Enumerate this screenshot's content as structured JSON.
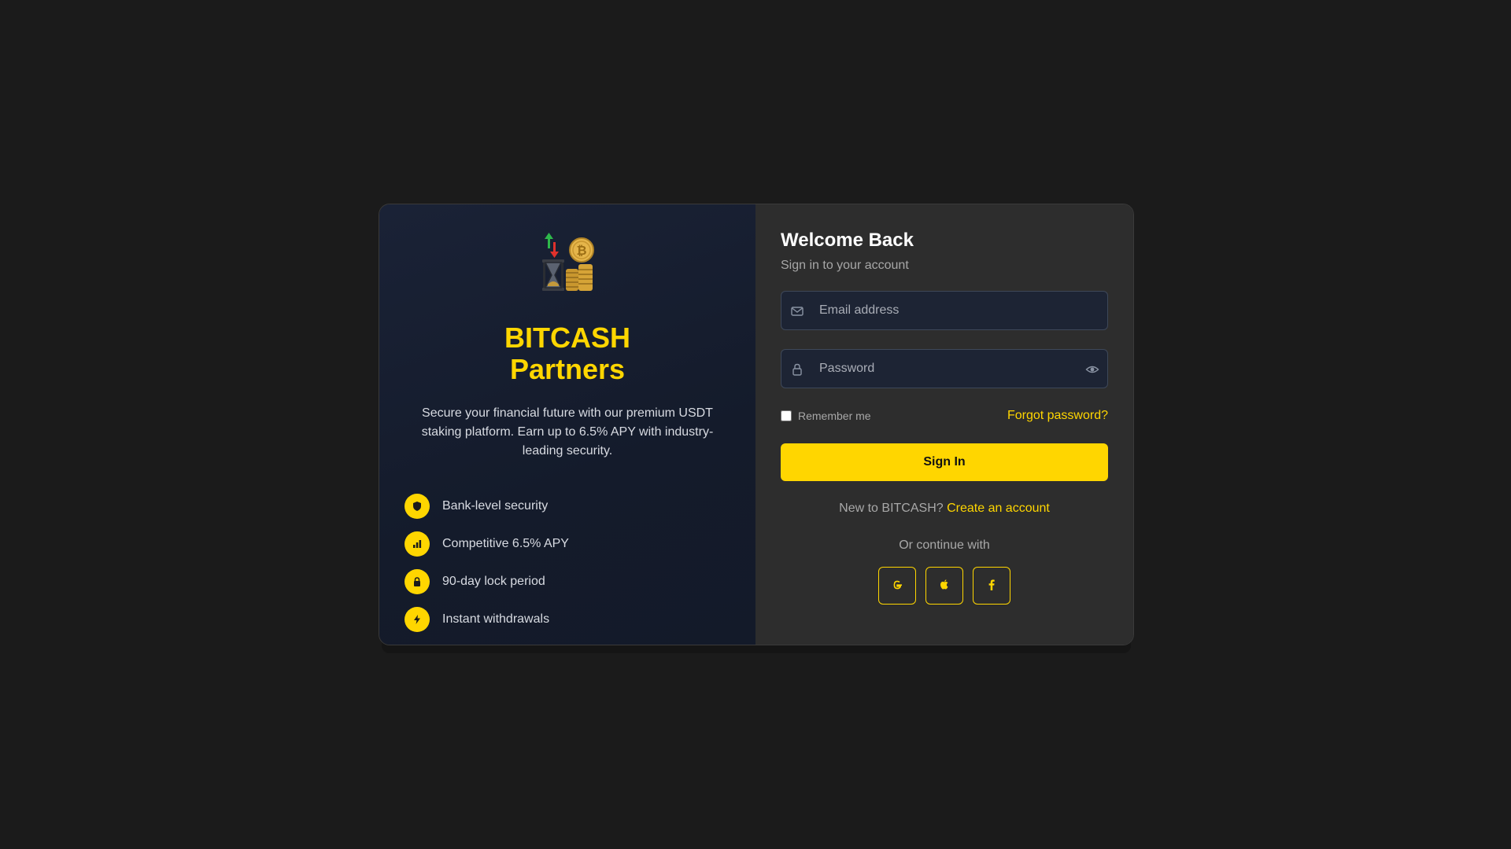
{
  "brand": {
    "name_line1": "BITCASH",
    "name_line2": "Partners",
    "tagline": "Secure your financial future with our premium USDT staking platform. Earn up to 6.5% APY with industry-leading security.",
    "logo_icon": "hourglass-bitcoin-coins-logo"
  },
  "features": [
    {
      "label": "Bank-level security",
      "icon": "shield-icon"
    },
    {
      "label": "Competitive 6.5% APY",
      "icon": "chart-icon"
    },
    {
      "label": "90-day lock period",
      "icon": "lock-icon"
    },
    {
      "label": "Instant withdrawals",
      "icon": "bolt-icon"
    }
  ],
  "form": {
    "title": "Welcome Back",
    "subtitle": "Sign in to your account",
    "email_placeholder": "Email address",
    "password_placeholder": "Password",
    "remember_label": "Remember me",
    "forgot_label": "Forgot password?",
    "submit_label": "Sign In",
    "register_prompt": "New to BITCASH?",
    "register_link": "Create an account",
    "continue_label": "Or continue with"
  },
  "socials": [
    {
      "icon": "google-icon"
    },
    {
      "icon": "apple-icon"
    },
    {
      "icon": "facebook-icon"
    }
  ],
  "colors": {
    "accent": "#ffd600",
    "page_background": "#1b1b1b",
    "left_panel": "#161d2d",
    "right_panel": "#2d2d2d"
  }
}
